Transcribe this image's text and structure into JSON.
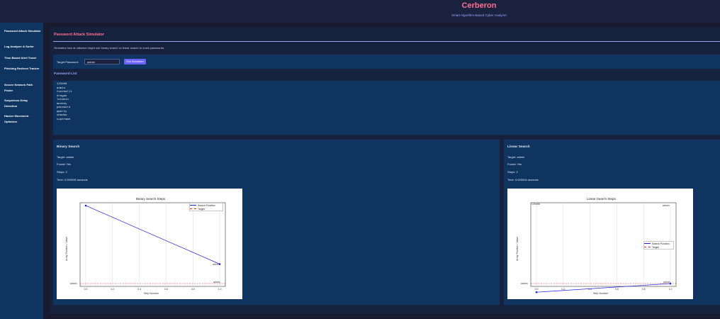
{
  "app": {
    "title": "Cerberon",
    "subtitle": "Smart Algorithm-Based Cyber Analyzer"
  },
  "sidebar": {
    "items": [
      {
        "label": "Password Attack Simulator"
      },
      {
        "label": "Log Analyzer & Sorter"
      },
      {
        "label": "Time-Based Alert Travel"
      },
      {
        "label": "Phishing Redirect Tracker"
      },
      {
        "label": "Secure Network Path Finder"
      },
      {
        "label": "Suspicious Delay Detection"
      },
      {
        "label": "Hacker Movement Optimizer"
      }
    ]
  },
  "panel": {
    "title": "Password Attack Simulator",
    "description": "Simulates how an attacker might use binary search vs linear search to crack passwords.",
    "target_label": "Target Password:",
    "target_value": "admin",
    "run_label": "Run Simulation",
    "list_heading": "Password List",
    "passwords": [
      "123456",
      "admin",
      "football1",
      "dragon",
      "letmein",
      "monkey",
      "password",
      "qwerty",
      "shadow",
      "superman"
    ]
  },
  "binary": {
    "title": "Binary Search",
    "target_line": "Target: admin",
    "found_line": "Found: Yes",
    "steps_line": "Steps: 2",
    "time_line": "Time: 0.000006 seconds",
    "plot": {
      "title": "Binary Search Steps",
      "xlabel": "Step Number",
      "ylabel": "Array Position / Value",
      "xticks": [
        "0.0",
        "0.2",
        "0.4",
        "0.6",
        "0.8",
        "1.0"
      ],
      "ytick_label": "admin",
      "point_labels": [
        "",
        "admin"
      ],
      "target_annotation": "admin",
      "legend": [
        "Search Position",
        "Target"
      ]
    }
  },
  "linear": {
    "title": "Linear Search",
    "target_line": "Target: admin",
    "found_line": "Found: Yes",
    "steps_line": "Steps: 2",
    "time_line": "Time: 0.000004 seconds",
    "plot": {
      "title": "Linear Search Steps",
      "xlabel": "Step Number",
      "ylabel": "Array Position / Value",
      "xticks": [
        "0.0",
        "0.2",
        "0.4",
        "0.6",
        "0.8",
        "1.0"
      ],
      "ytick_label": "admin",
      "point_labels": [
        "123456",
        "admin"
      ],
      "target_annotation": "admin",
      "legend": [
        "Search Position",
        "Target"
      ]
    }
  },
  "colors": {
    "accent_pink": "#ff6f91",
    "accent_purple": "#6c63ff",
    "line_blue": "#2222dd",
    "target_red": "#d62728"
  },
  "chart_data": [
    {
      "type": "line",
      "title": "Binary Search Steps",
      "xlabel": "Step Number",
      "ylabel": "Array Position / Value",
      "x": [
        0,
        1
      ],
      "series": [
        {
          "name": "Search Position",
          "values": [
            4,
            1
          ]
        },
        {
          "name": "Target",
          "values": [
            0,
            0
          ]
        }
      ],
      "xlim": [
        0,
        1
      ],
      "legend": "top-right",
      "grid": true
    },
    {
      "type": "line",
      "title": "Linear Search Steps",
      "xlabel": "Step Number",
      "ylabel": "Array Position / Value",
      "x": [
        0,
        1
      ],
      "series": [
        {
          "name": "Search Position",
          "values": [
            0,
            1
          ]
        },
        {
          "name": "Target",
          "values": [
            1,
            1
          ]
        }
      ],
      "xlim": [
        0,
        1
      ],
      "legend": "center-right",
      "grid": true
    }
  ]
}
